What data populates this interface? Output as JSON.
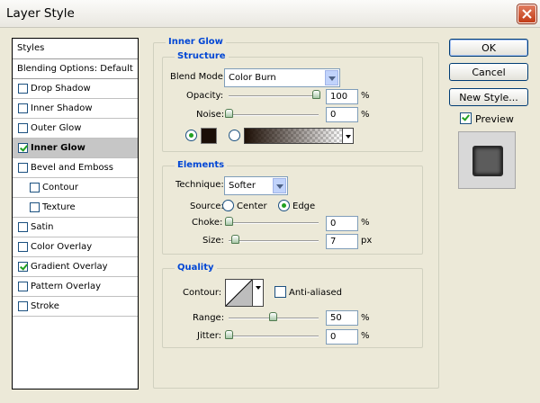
{
  "window": {
    "title": "Layer Style"
  },
  "styles_list": {
    "header": "Styles",
    "blending": "Blending Options: Default",
    "items": [
      {
        "label": "Drop Shadow",
        "checked": false
      },
      {
        "label": "Inner Shadow",
        "checked": false
      },
      {
        "label": "Outer Glow",
        "checked": false
      },
      {
        "label": "Inner Glow",
        "checked": true,
        "selected": true
      },
      {
        "label": "Bevel and Emboss",
        "checked": false
      },
      {
        "label": "Contour",
        "checked": false,
        "sub": true
      },
      {
        "label": "Texture",
        "checked": false,
        "sub": true
      },
      {
        "label": "Satin",
        "checked": false
      },
      {
        "label": "Color Overlay",
        "checked": false
      },
      {
        "label": "Gradient Overlay",
        "checked": true
      },
      {
        "label": "Pattern Overlay",
        "checked": false
      },
      {
        "label": "Stroke",
        "checked": false
      }
    ]
  },
  "panel": {
    "title": "Inner Glow",
    "structure": {
      "title": "Structure",
      "blend_mode_label": "Blend Mode:",
      "blend_mode": "Color Burn",
      "opacity_label": "Opacity:",
      "opacity": "100",
      "noise_label": "Noise:",
      "noise": "0",
      "percent": "%",
      "glow_color": "#1a0e07",
      "color_mode": "solid"
    },
    "elements": {
      "title": "Elements",
      "technique_label": "Technique:",
      "technique": "Softer",
      "source_label": "Source:",
      "source_center": "Center",
      "source_edge": "Edge",
      "source_selected": "Edge",
      "choke_label": "Choke:",
      "choke": "0",
      "size_label": "Size:",
      "size": "7",
      "px": "px",
      "percent": "%"
    },
    "quality": {
      "title": "Quality",
      "contour_label": "Contour:",
      "anti_aliased_label": "Anti-aliased",
      "anti_aliased": false,
      "range_label": "Range:",
      "range": "50",
      "jitter_label": "Jitter:",
      "jitter": "0",
      "percent": "%"
    }
  },
  "buttons": {
    "ok": "OK",
    "cancel": "Cancel",
    "new_style": "New Style...",
    "preview_label": "Preview",
    "preview_checked": true
  }
}
